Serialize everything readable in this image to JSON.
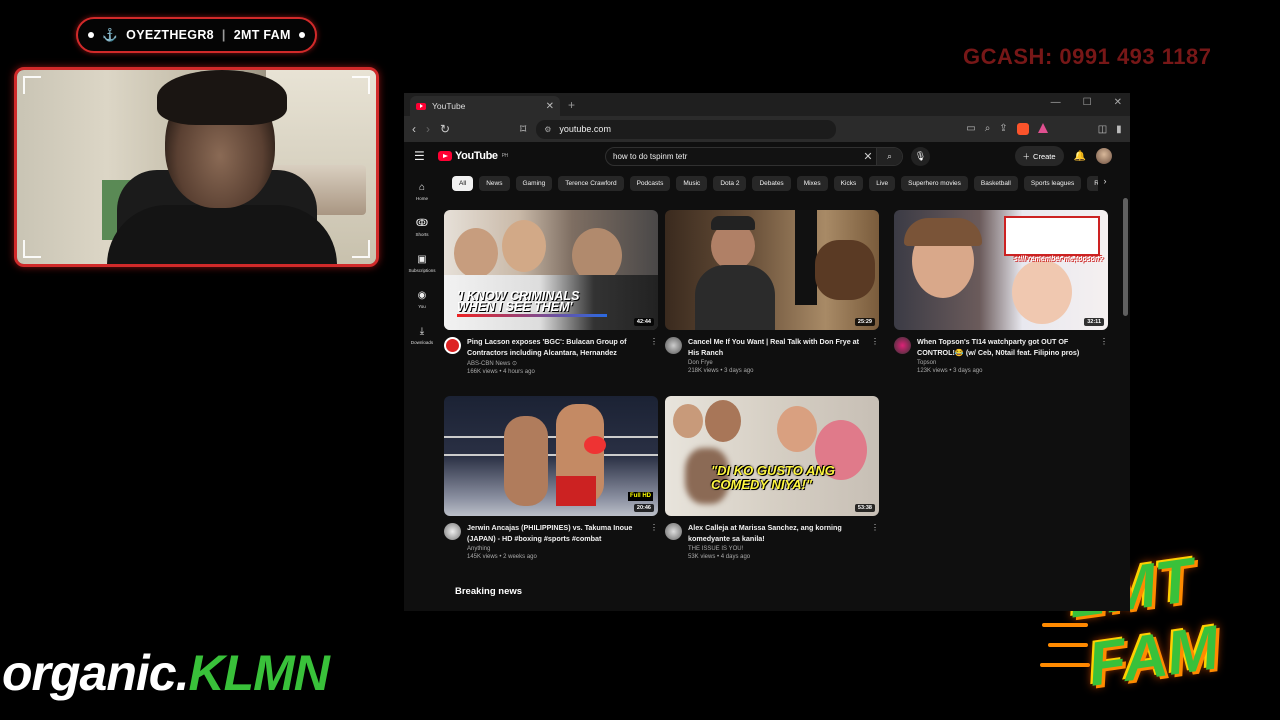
{
  "overlay": {
    "streamer": "OYEZTHEGR8",
    "team": "2MT FAM",
    "gcash": "GCASH: 0991 493 1187",
    "brand_a": "organic.",
    "brand_b": "KLMN",
    "logo_line1": "2MT",
    "logo_line2": "FAM"
  },
  "browser": {
    "tab_title": "YouTube",
    "url": "youtube.com"
  },
  "youtube": {
    "logo_text": "YouTube",
    "region": "PH",
    "search_query": "how to do tspinm tetr",
    "create_label": "Create",
    "sidebar": [
      {
        "label": "Home",
        "icon": "home-icon"
      },
      {
        "label": "Shorts",
        "icon": "shorts-icon"
      },
      {
        "label": "Subscriptions",
        "icon": "subscriptions-icon"
      },
      {
        "label": "You",
        "icon": "you-icon"
      },
      {
        "label": "Downloads",
        "icon": "downloads-icon"
      }
    ],
    "chips": [
      "All",
      "News",
      "Gaming",
      "Terence Crawford",
      "Podcasts",
      "Music",
      "Dota 2",
      "Debates",
      "Mixes",
      "Kicks",
      "Live",
      "Superhero movies",
      "Basketball",
      "Sports leagues",
      "Re"
    ],
    "videos": [
      {
        "title": "Ping Lacson exposes 'BGC': Bulacan Group of Contractors including Alcantara, Hernandez",
        "channel": "ABS-CBN News ⊙",
        "stats": "166K views • 4 hours ago",
        "duration": "42:44",
        "caption": "'I KNOW CRIMINALS WHEN I SEE THEM'"
      },
      {
        "title": "Cancel Me If You Want | Real Talk with Don Frye at His Ranch",
        "channel": "Don Frye",
        "stats": "218K views • 3 days ago",
        "duration": "25:29",
        "caption": ""
      },
      {
        "title": "When Topson's TI14 watchparty got OUT OF CONTROL!😂 (w/ Ceb, N0tail feat. Filipino pros)",
        "channel": "Topson",
        "stats": "123K views • 3 days ago",
        "duration": "32:11",
        "caption": "still remember me,topson?"
      },
      {
        "title": "Jerwin Ancajas (PHILIPPINES) vs. Takuma Inoue (JAPAN) - HD #boxing #sports #combat",
        "channel": "Anything",
        "stats": "145K views • 2 weeks ago",
        "duration": "20:46",
        "caption": "Full HD"
      },
      {
        "title": "Alex Calleja at Marissa Sanchez, ang korning komedyante sa kanila!",
        "channel": "THE ISSUE IS YOU!",
        "stats": "53K views • 4 days ago",
        "duration": "53:38",
        "caption": "\"DI KO GUSTO ANG COMEDY NIYA!\""
      }
    ],
    "section_title": "Breaking news"
  }
}
